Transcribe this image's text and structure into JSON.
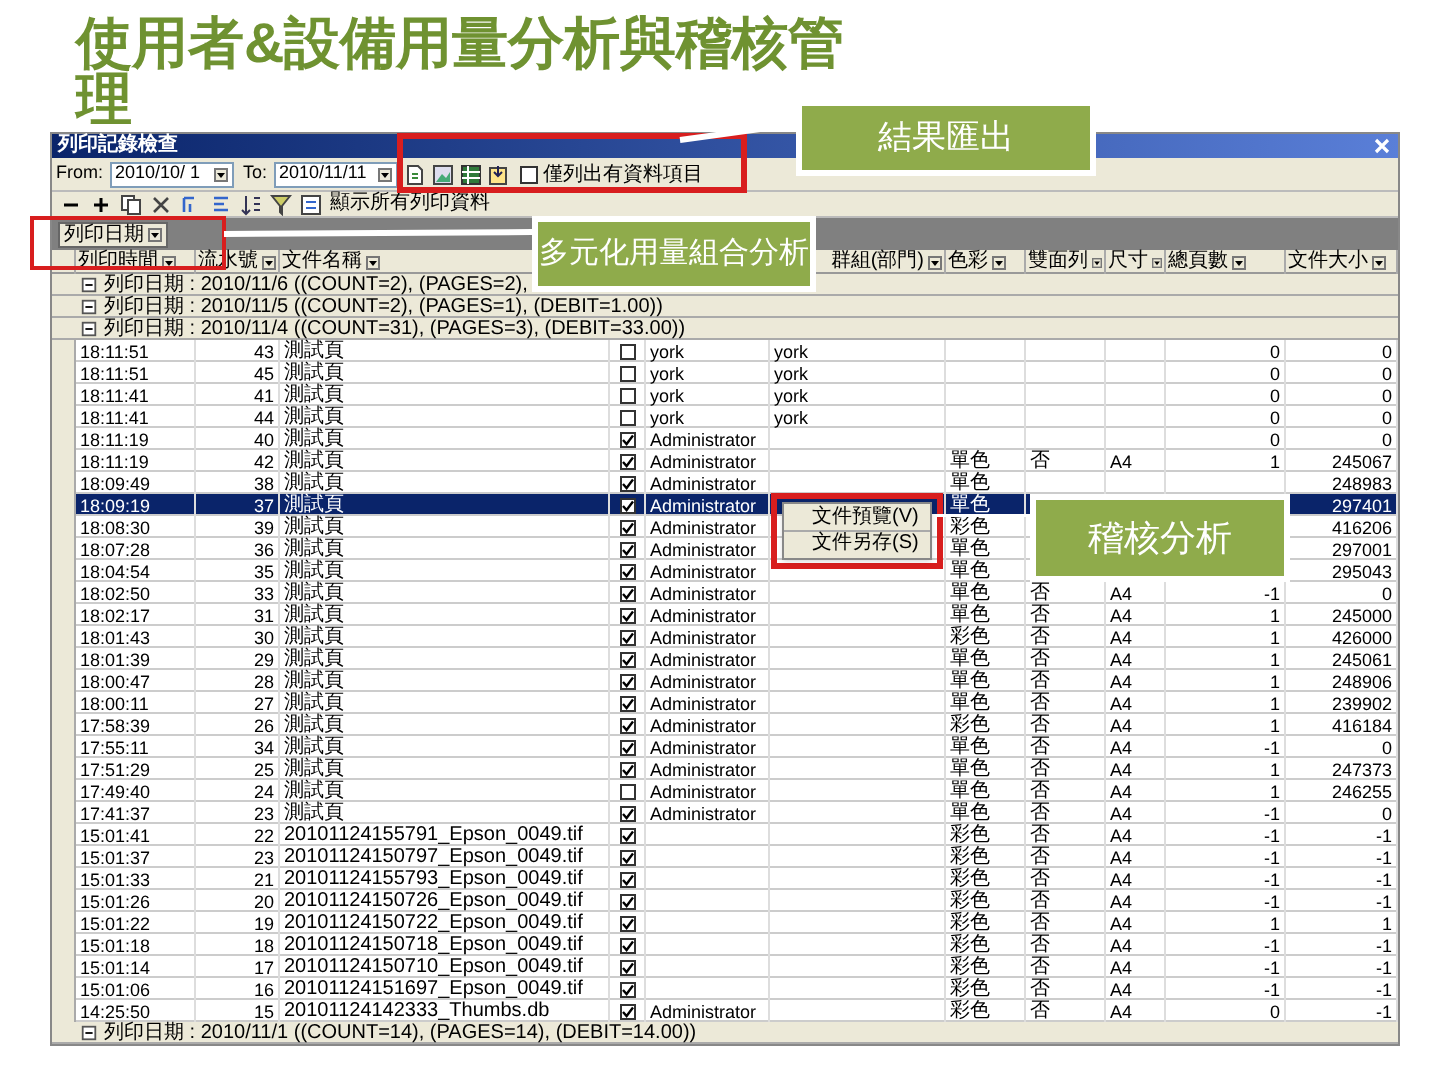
{
  "title": "使用者&設備用量分析與稽核管理",
  "window": {
    "title": "列印記錄檢查",
    "from_label": "From:",
    "from_value": "2010/10/ 1",
    "to_label": "To:",
    "to_value": "2010/11/11",
    "option": {
      "label": "僅列出有資料項目",
      "checked": false
    },
    "toolbar_label": "顯示所有列印資料",
    "group_chip": "列印日期"
  },
  "columns": [
    {
      "label": "列印時間"
    },
    {
      "label": "流水號"
    },
    {
      "label": "文件名稱"
    },
    {
      "label": "群組(部門)"
    },
    {
      "label": "色彩"
    },
    {
      "label": "雙面列"
    },
    {
      "label": "尺寸"
    },
    {
      "label": "總頁數"
    },
    {
      "label": "文件大小"
    }
  ],
  "rows": [
    {
      "kind": "group",
      "text": "列印日期 : 2010/11/6 ((COUNT=2), (PAGES=2),"
    },
    {
      "kind": "group",
      "text": "列印日期 : 2010/11/5 ((COUNT=2), (PAGES=1), (DEBIT=1.00))"
    },
    {
      "kind": "group",
      "text": "列印日期 : 2010/11/4 ((COUNT=31), (PAGES=3), (DEBIT=33.00))"
    },
    {
      "kind": "record",
      "selected": false,
      "time": "18:11:51",
      "number": "43",
      "document": "測試頁",
      "checked": false,
      "user": "york",
      "owner": "york",
      "pages": "0",
      "file_size": "0"
    },
    {
      "kind": "record",
      "selected": false,
      "time": "18:11:51",
      "number": "45",
      "document": "測試頁",
      "checked": false,
      "user": "york",
      "owner": "york",
      "pages": "0",
      "file_size": "0"
    },
    {
      "kind": "record",
      "selected": false,
      "time": "18:11:41",
      "number": "41",
      "document": "測試頁",
      "checked": false,
      "user": "york",
      "owner": "york",
      "pages": "0",
      "file_size": "0"
    },
    {
      "kind": "record",
      "selected": false,
      "time": "18:11:41",
      "number": "44",
      "document": "測試頁",
      "checked": false,
      "user": "york",
      "owner": "york",
      "pages": "0",
      "file_size": "0"
    },
    {
      "kind": "record",
      "selected": false,
      "time": "18:11:19",
      "number": "40",
      "document": "測試頁",
      "checked": true,
      "user": "Administrator",
      "pages": "0",
      "file_size": "0"
    },
    {
      "kind": "record",
      "selected": false,
      "time": "18:11:19",
      "number": "42",
      "document": "測試頁",
      "checked": true,
      "user": "Administrator",
      "color_mode": "單色",
      "duplex": "否",
      "paper_size": "A4",
      "pages": "1",
      "file_size": "245067"
    },
    {
      "kind": "record",
      "selected": false,
      "time": "18:09:49",
      "number": "38",
      "document": "測試頁",
      "checked": true,
      "user": "Administrator",
      "color_mode": "單色",
      "file_size": "248983"
    },
    {
      "kind": "record",
      "selected": true,
      "time": "18:09:19",
      "number": "37",
      "document": "測試頁",
      "checked": true,
      "user": "Administrator",
      "color_mode": "單色",
      "file_size": "297401"
    },
    {
      "kind": "record",
      "selected": false,
      "time": "18:08:30",
      "number": "39",
      "document": "測試頁",
      "checked": true,
      "user": "Administrator",
      "color_mode": "彩色",
      "file_size": "416206"
    },
    {
      "kind": "record",
      "selected": false,
      "time": "18:07:28",
      "number": "36",
      "document": "測試頁",
      "checked": true,
      "user": "Administrator",
      "color_mode": "單色",
      "file_size": "297001"
    },
    {
      "kind": "record",
      "selected": false,
      "time": "18:04:54",
      "number": "35",
      "document": "測試頁",
      "checked": true,
      "user": "Administrator",
      "color_mode": "單色",
      "file_size": "295043"
    },
    {
      "kind": "record",
      "selected": false,
      "time": "18:02:50",
      "number": "33",
      "document": "測試頁",
      "checked": true,
      "user": "Administrator",
      "color_mode": "單色",
      "duplex": "否",
      "paper_size": "A4",
      "pages": "-1",
      "file_size": "0"
    },
    {
      "kind": "record",
      "selected": false,
      "time": "18:02:17",
      "number": "31",
      "document": "測試頁",
      "checked": true,
      "user": "Administrator",
      "color_mode": "單色",
      "duplex": "否",
      "paper_size": "A4",
      "pages": "1",
      "file_size": "245000"
    },
    {
      "kind": "record",
      "selected": false,
      "time": "18:01:43",
      "number": "30",
      "document": "測試頁",
      "checked": true,
      "user": "Administrator",
      "color_mode": "彩色",
      "duplex": "否",
      "paper_size": "A4",
      "pages": "1",
      "file_size": "426000"
    },
    {
      "kind": "record",
      "selected": false,
      "time": "18:01:39",
      "number": "29",
      "document": "測試頁",
      "checked": true,
      "user": "Administrator",
      "color_mode": "單色",
      "duplex": "否",
      "paper_size": "A4",
      "pages": "1",
      "file_size": "245061"
    },
    {
      "kind": "record",
      "selected": false,
      "time": "18:00:47",
      "number": "28",
      "document": "測試頁",
      "checked": true,
      "user": "Administrator",
      "color_mode": "單色",
      "duplex": "否",
      "paper_size": "A4",
      "pages": "1",
      "file_size": "248906"
    },
    {
      "kind": "record",
      "selected": false,
      "time": "18:00:11",
      "number": "27",
      "document": "測試頁",
      "checked": true,
      "user": "Administrator",
      "color_mode": "單色",
      "duplex": "否",
      "paper_size": "A4",
      "pages": "1",
      "file_size": "239902"
    },
    {
      "kind": "record",
      "selected": false,
      "time": "17:58:39",
      "number": "26",
      "document": "測試頁",
      "checked": true,
      "user": "Administrator",
      "color_mode": "彩色",
      "duplex": "否",
      "paper_size": "A4",
      "pages": "1",
      "file_size": "416184"
    },
    {
      "kind": "record",
      "selected": false,
      "time": "17:55:11",
      "number": "34",
      "document": "測試頁",
      "checked": true,
      "user": "Administrator",
      "color_mode": "單色",
      "duplex": "否",
      "paper_size": "A4",
      "pages": "-1",
      "file_size": "0"
    },
    {
      "kind": "record",
      "selected": false,
      "time": "17:51:29",
      "number": "25",
      "document": "測試頁",
      "checked": true,
      "user": "Administrator",
      "color_mode": "單色",
      "duplex": "否",
      "paper_size": "A4",
      "pages": "1",
      "file_size": "247373"
    },
    {
      "kind": "record",
      "selected": false,
      "time": "17:49:40",
      "number": "24",
      "document": "測試頁",
      "checked": false,
      "user": "Administrator",
      "color_mode": "單色",
      "duplex": "否",
      "paper_size": "A4",
      "pages": "1",
      "file_size": "246255"
    },
    {
      "kind": "record",
      "selected": false,
      "time": "17:41:37",
      "number": "23",
      "document": "測試頁",
      "checked": true,
      "user": "Administrator",
      "color_mode": "單色",
      "duplex": "否",
      "paper_size": "A4",
      "pages": "-1",
      "file_size": "0"
    },
    {
      "kind": "record",
      "selected": false,
      "time": "15:01:41",
      "number": "22",
      "document": "20101124155791_Epson_0049.tif",
      "checked": true,
      "color_mode": "彩色",
      "duplex": "否",
      "paper_size": "A4",
      "pages": "-1",
      "file_size": "-1"
    },
    {
      "kind": "record",
      "selected": false,
      "time": "15:01:37",
      "number": "23",
      "document": "20101124150797_Epson_0049.tif",
      "checked": true,
      "color_mode": "彩色",
      "duplex": "否",
      "paper_size": "A4",
      "pages": "-1",
      "file_size": "-1"
    },
    {
      "kind": "record",
      "selected": false,
      "time": "15:01:33",
      "number": "21",
      "document": "20101124155793_Epson_0049.tif",
      "checked": true,
      "color_mode": "彩色",
      "duplex": "否",
      "paper_size": "A4",
      "pages": "-1",
      "file_size": "-1"
    },
    {
      "kind": "record",
      "selected": false,
      "time": "15:01:26",
      "number": "20",
      "document": "20101124150726_Epson_0049.tif",
      "checked": true,
      "color_mode": "彩色",
      "duplex": "否",
      "paper_size": "A4",
      "pages": "-1",
      "file_size": "-1"
    },
    {
      "kind": "record",
      "selected": false,
      "time": "15:01:22",
      "number": "19",
      "document": "20101124150722_Epson_0049.tif",
      "checked": true,
      "color_mode": "彩色",
      "duplex": "否",
      "paper_size": "A4",
      "pages": "1",
      "file_size": "1"
    },
    {
      "kind": "record",
      "selected": false,
      "time": "15:01:18",
      "number": "18",
      "document": "20101124150718_Epson_0049.tif",
      "checked": true,
      "color_mode": "彩色",
      "duplex": "否",
      "paper_size": "A4",
      "pages": "-1",
      "file_size": "-1"
    },
    {
      "kind": "record",
      "selected": false,
      "time": "15:01:14",
      "number": "17",
      "document": "20101124150710_Epson_0049.tif",
      "checked": true,
      "color_mode": "彩色",
      "duplex": "否",
      "paper_size": "A4",
      "pages": "-1",
      "file_size": "-1"
    },
    {
      "kind": "record",
      "selected": false,
      "time": "15:01:06",
      "number": "16",
      "document": "20101124151697_Epson_0049.tif",
      "checked": true,
      "color_mode": "彩色",
      "duplex": "否",
      "paper_size": "A4",
      "pages": "-1",
      "file_size": "-1"
    },
    {
      "kind": "record",
      "selected": false,
      "time": "14:25:50",
      "number": "15",
      "document": "20101124142333_Thumbs.db",
      "checked": true,
      "user": "Administrator",
      "color_mode": "彩色",
      "duplex": "否",
      "paper_size": "A4",
      "pages": "0",
      "file_size": "-1"
    },
    {
      "kind": "group",
      "text": "列印日期 : 2010/11/1 ((COUNT=14), (PAGES=14), (DEBIT=14.00))"
    }
  ],
  "context_menu": [
    {
      "label": "文件預覽(V)"
    },
    {
      "label": "文件另存(S)"
    }
  ],
  "callouts": [
    {
      "text": "結果匯出"
    },
    {
      "text": "多元化用量組合分析"
    },
    {
      "text": "稽核分析"
    }
  ]
}
